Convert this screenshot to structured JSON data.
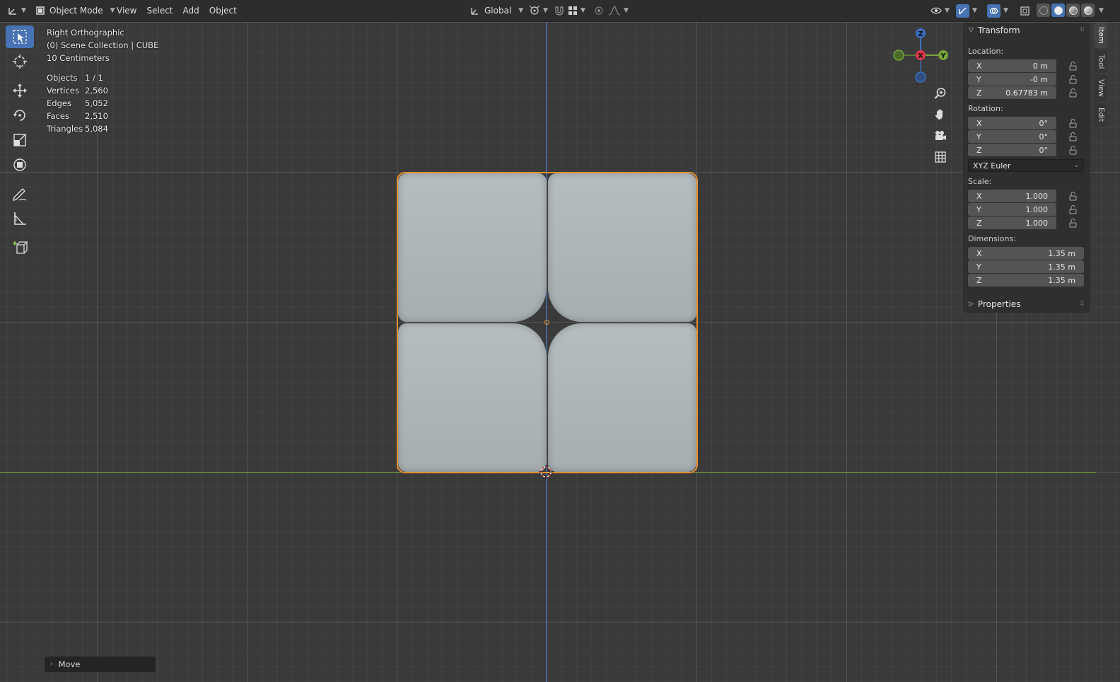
{
  "header": {
    "mode": "Object Mode",
    "menus": [
      "View",
      "Select",
      "Add",
      "Object"
    ],
    "orientation": "Global"
  },
  "overlay": {
    "view_name": "Right Orthographic",
    "collection": "(0) Scene Collection | CUBE",
    "grid_scale": "10 Centimeters",
    "stats": [
      {
        "label": "Objects",
        "value": "1 / 1"
      },
      {
        "label": "Vertices",
        "value": "2,560"
      },
      {
        "label": "Edges",
        "value": "5,052"
      },
      {
        "label": "Faces",
        "value": "2,510"
      },
      {
        "label": "Triangles",
        "value": "5,084"
      }
    ]
  },
  "gizmo": {
    "z": "Z",
    "x": "X",
    "y": "Y"
  },
  "panel": {
    "title": "Transform",
    "location_label": "Location:",
    "location": [
      {
        "axis": "X",
        "value": "0 m"
      },
      {
        "axis": "Y",
        "value": "-0 m"
      },
      {
        "axis": "Z",
        "value": "0.67783 m"
      }
    ],
    "rotation_label": "Rotation:",
    "rotation": [
      {
        "axis": "X",
        "value": "0°"
      },
      {
        "axis": "Y",
        "value": "0°"
      },
      {
        "axis": "Z",
        "value": "0°"
      }
    ],
    "rotation_mode": "XYZ Euler",
    "scale_label": "Scale:",
    "scale": [
      {
        "axis": "X",
        "value": "1.000"
      },
      {
        "axis": "Y",
        "value": "1.000"
      },
      {
        "axis": "Z",
        "value": "1.000"
      }
    ],
    "dimensions_label": "Dimensions:",
    "dimensions": [
      {
        "axis": "X",
        "value": "1.35 m"
      },
      {
        "axis": "Y",
        "value": "1.35 m"
      },
      {
        "axis": "Z",
        "value": "1.35 m"
      }
    ],
    "properties_title": "Properties"
  },
  "side_tabs": [
    "Item",
    "Tool",
    "View",
    "Edit"
  ],
  "last_operator": "Move",
  "colors": {
    "accent": "#4772b3",
    "selection_outline": "#e8902f",
    "axis_x": "#e2364c",
    "axis_y": "#79a43a",
    "axis_z": "#3a6fc2"
  }
}
